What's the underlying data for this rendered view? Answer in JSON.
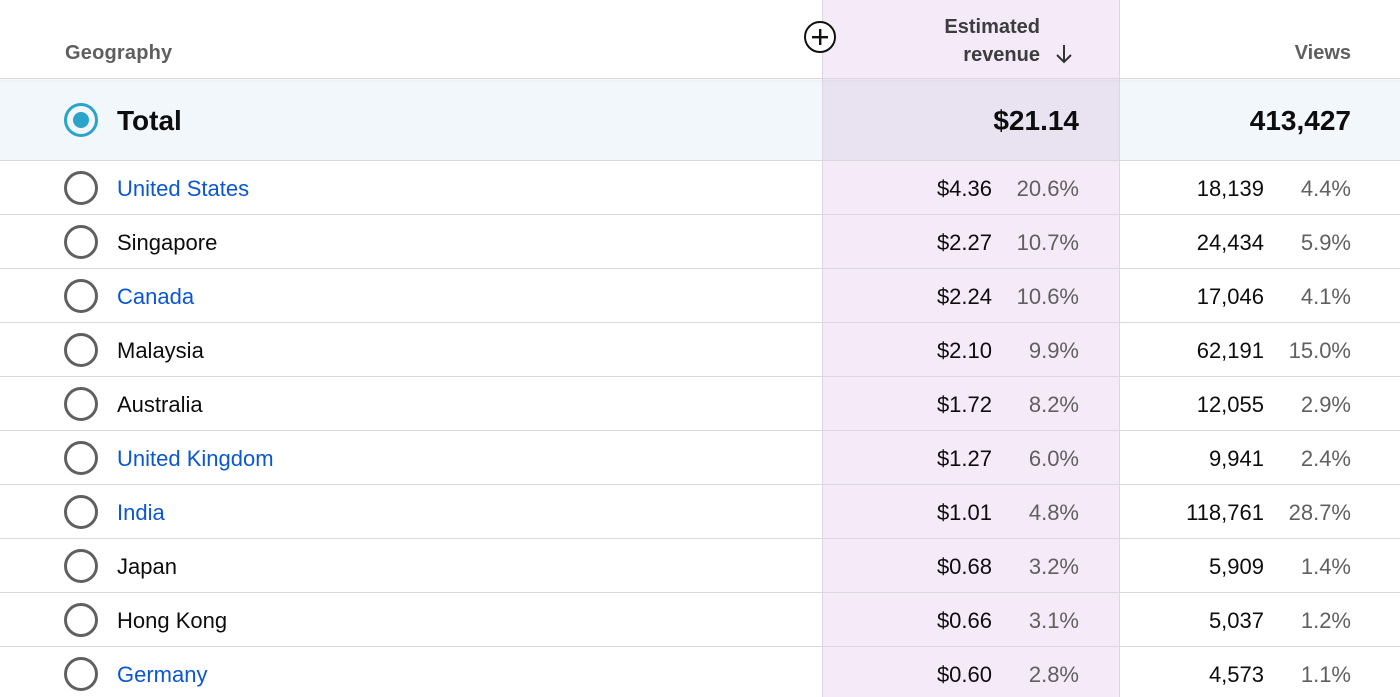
{
  "header": {
    "geography_label": "Geography",
    "revenue_label_line1": "Estimated",
    "revenue_label_line2": "revenue",
    "views_label": "Views",
    "sort_direction": "descending",
    "add_column_icon": "add-circle-icon",
    "sort_icon": "arrow-down-icon"
  },
  "total": {
    "label": "Total",
    "revenue": "$21.14",
    "views": "413,427",
    "selected": true
  },
  "colors": {
    "link": "#0b57d0",
    "radio_selected": "#2aa4c9",
    "revenue_column_bg": "#f5eaf8",
    "total_row_bg": "#f1f7fb"
  },
  "rows": [
    {
      "name": "United States",
      "link": true,
      "revenue": "$4.36",
      "revenue_pct": "20.6%",
      "views": "18,139",
      "views_pct": "4.4%"
    },
    {
      "name": "Singapore",
      "link": false,
      "revenue": "$2.27",
      "revenue_pct": "10.7%",
      "views": "24,434",
      "views_pct": "5.9%"
    },
    {
      "name": "Canada",
      "link": true,
      "revenue": "$2.24",
      "revenue_pct": "10.6%",
      "views": "17,046",
      "views_pct": "4.1%"
    },
    {
      "name": "Malaysia",
      "link": false,
      "revenue": "$2.10",
      "revenue_pct": "9.9%",
      "views": "62,191",
      "views_pct": "15.0%"
    },
    {
      "name": "Australia",
      "link": false,
      "revenue": "$1.72",
      "revenue_pct": "8.2%",
      "views": "12,055",
      "views_pct": "2.9%"
    },
    {
      "name": "United Kingdom",
      "link": true,
      "revenue": "$1.27",
      "revenue_pct": "6.0%",
      "views": "9,941",
      "views_pct": "2.4%"
    },
    {
      "name": "India",
      "link": true,
      "revenue": "$1.01",
      "revenue_pct": "4.8%",
      "views": "118,761",
      "views_pct": "28.7%"
    },
    {
      "name": "Japan",
      "link": false,
      "revenue": "$0.68",
      "revenue_pct": "3.2%",
      "views": "5,909",
      "views_pct": "1.4%"
    },
    {
      "name": "Hong Kong",
      "link": false,
      "revenue": "$0.66",
      "revenue_pct": "3.1%",
      "views": "5,037",
      "views_pct": "1.2%"
    },
    {
      "name": "Germany",
      "link": true,
      "revenue": "$0.60",
      "revenue_pct": "2.8%",
      "views": "4,573",
      "views_pct": "1.1%"
    }
  ]
}
